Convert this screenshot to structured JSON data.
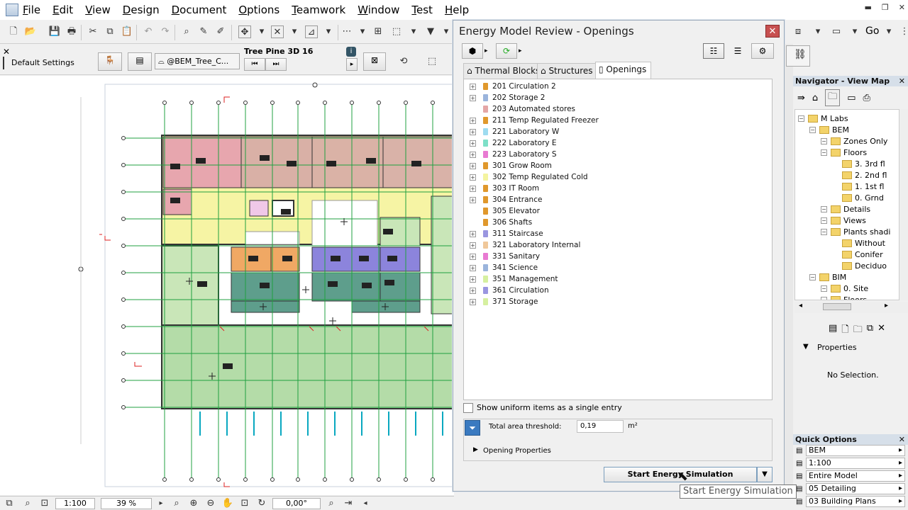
{
  "menu": [
    "File",
    "Edit",
    "View",
    "Design",
    "Document",
    "Options",
    "Teamwork",
    "Window",
    "Test",
    "Help"
  ],
  "info_bar": {
    "default_settings": "Default Settings",
    "object_name": "@BEM_Tree_C...",
    "library_name": "Tree Pine 3D 16"
  },
  "dialog": {
    "title": "Energy Model Review - Openings",
    "tabs": [
      {
        "label": "Thermal Blocks",
        "active": false
      },
      {
        "label": "Structures",
        "active": false
      },
      {
        "label": "Openings",
        "active": true
      }
    ],
    "rows": [
      {
        "label": "201 Circulation 2",
        "color": "#e0982c",
        "expandable": true
      },
      {
        "label": "202 Storage 2",
        "color": "#9ab4dc",
        "expandable": true
      },
      {
        "label": "203 Automated stores",
        "color": "#e4a6a6",
        "expandable": false
      },
      {
        "label": "211 Temp Regulated Freezer",
        "color": "#e0982c",
        "expandable": true
      },
      {
        "label": "221 Laboratory W",
        "color": "#9edcf0",
        "expandable": true
      },
      {
        "label": "222 Laboratory E",
        "color": "#7ee0c8",
        "expandable": true
      },
      {
        "label": "223 Laboratory S",
        "color": "#e87ad2",
        "expandable": true
      },
      {
        "label": "301 Grow Room",
        "color": "#e0982c",
        "expandable": true
      },
      {
        "label": "302 Temp Regulated Cold",
        "color": "#f4f4a0",
        "expandable": true
      },
      {
        "label": "303 IT Room",
        "color": "#e0982c",
        "expandable": true
      },
      {
        "label": "304 Entrance",
        "color": "#e0982c",
        "expandable": true
      },
      {
        "label": "305 Elevator",
        "color": "#e0982c",
        "expandable": false
      },
      {
        "label": "306 Shafts",
        "color": "#e0982c",
        "expandable": false
      },
      {
        "label": "311 Staircase",
        "color": "#9a96e0",
        "expandable": true
      },
      {
        "label": "321 Laboratory Internal",
        "color": "#f0c89a",
        "expandable": true
      },
      {
        "label": "331 Sanitary",
        "color": "#e87ad2",
        "expandable": true
      },
      {
        "label": "341 Science",
        "color": "#9ab4dc",
        "expandable": true
      },
      {
        "label": "351 Management",
        "color": "#d6f0a0",
        "expandable": true
      },
      {
        "label": "361 Circulation",
        "color": "#9a96e0",
        "expandable": true
      },
      {
        "label": "371 Storage",
        "color": "#d6f0a0",
        "expandable": true
      }
    ],
    "show_uniform_label": "Show uniform items as a single entry",
    "threshold_label": "Total area threshold:",
    "threshold_value": "0,19",
    "threshold_unit": "m²",
    "opening_properties_label": "Opening Properties",
    "start_button": "Start Energy Simulation"
  },
  "tooltip": "Start Energy Simulation",
  "navigator": {
    "header": "Navigator - View Map",
    "tree": [
      {
        "label": "M Labs",
        "indent": 0
      },
      {
        "label": "BEM",
        "indent": 1
      },
      {
        "label": "Zones Only",
        "indent": 2
      },
      {
        "label": "Floors",
        "indent": 2
      },
      {
        "label": "3. 3rd fl",
        "indent": 3
      },
      {
        "label": "2. 2nd fl",
        "indent": 3
      },
      {
        "label": "1. 1st fl",
        "indent": 3
      },
      {
        "label": "0. Grnd",
        "indent": 3
      },
      {
        "label": "Details",
        "indent": 2
      },
      {
        "label": "Views",
        "indent": 2
      },
      {
        "label": "Plants shadi",
        "indent": 2
      },
      {
        "label": "Without",
        "indent": 3
      },
      {
        "label": "Conifer",
        "indent": 3
      },
      {
        "label": "Deciduo",
        "indent": 3
      },
      {
        "label": "BIM",
        "indent": 1
      },
      {
        "label": "0. Site",
        "indent": 2
      },
      {
        "label": "Floors",
        "indent": 2
      }
    ]
  },
  "properties": {
    "header": "Properties",
    "empty_text": "No Selection."
  },
  "quick_options": {
    "header": "Quick Options",
    "items": [
      "BEM",
      "1:100",
      "Entire Model",
      "05 Detailing",
      "03 Building Plans"
    ]
  },
  "toolbar_right": {
    "go_label": "Go"
  },
  "status": {
    "scale": "1:100",
    "zoom": "39 %",
    "angle": "0,00°"
  }
}
